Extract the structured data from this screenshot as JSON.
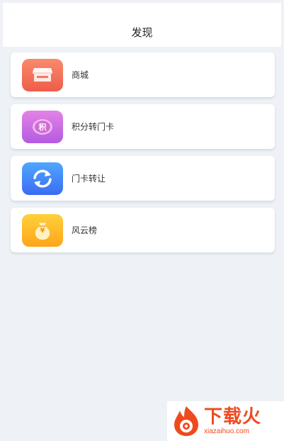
{
  "header": {
    "title": "发现"
  },
  "menu": [
    {
      "label": "商城",
      "icon": "shop-icon",
      "color_top": "#f98a6c",
      "color_bottom": "#ee5d4a"
    },
    {
      "label": "积分转门卡",
      "icon": "points-icon",
      "icon_text": "积",
      "color_top": "#e383e6",
      "color_bottom": "#b45ae0"
    },
    {
      "label": "门卡转让",
      "icon": "transfer-icon",
      "color_top": "#4fa7ff",
      "color_bottom": "#3b6cf2"
    },
    {
      "label": "风云榜",
      "icon": "money-bag-icon",
      "icon_text": "¥",
      "color_top": "#ffd03a",
      "color_bottom": "#ffa51a"
    }
  ],
  "watermark": {
    "main": "下载火",
    "sub": "xiazaihuo.com"
  }
}
